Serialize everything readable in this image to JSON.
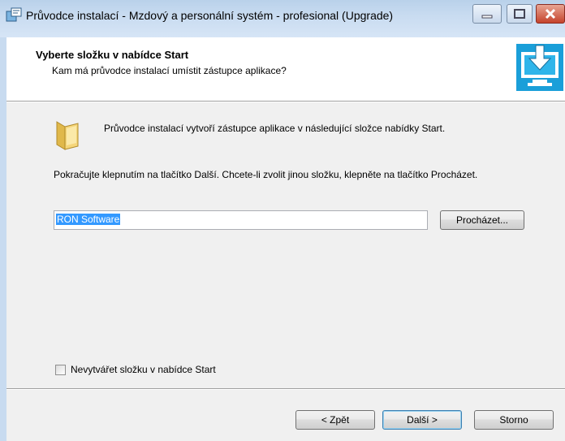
{
  "window": {
    "title": "Průvodce instalací - Mzdový a personální systém - profesional (Upgrade)"
  },
  "header": {
    "title": "Vyberte složku v nabídce Start",
    "subtitle": "Kam má průvodce instalací umístit zástupce aplikace?"
  },
  "main": {
    "intro_text": "Průvodce instalací vytvoří zástupce aplikace v následující složce nabídky Start.",
    "instruction_text": "Pokračujte klepnutím na tlačítko Další. Chcete-li zvolit jinou složku, klepněte na tlačítko Procházet.",
    "folder_value": "RON Software",
    "browse_label": "Procházet...",
    "no_folder_checkbox_label": "Nevytvářet složku v nabídce Start",
    "no_folder_checked": false
  },
  "footer": {
    "back_label": "< Zpět",
    "next_label": "Další >",
    "cancel_label": "Storno"
  },
  "icons": {
    "app": "setup-icon",
    "header": "install-monitor-icon",
    "folder": "folder-icon"
  }
}
